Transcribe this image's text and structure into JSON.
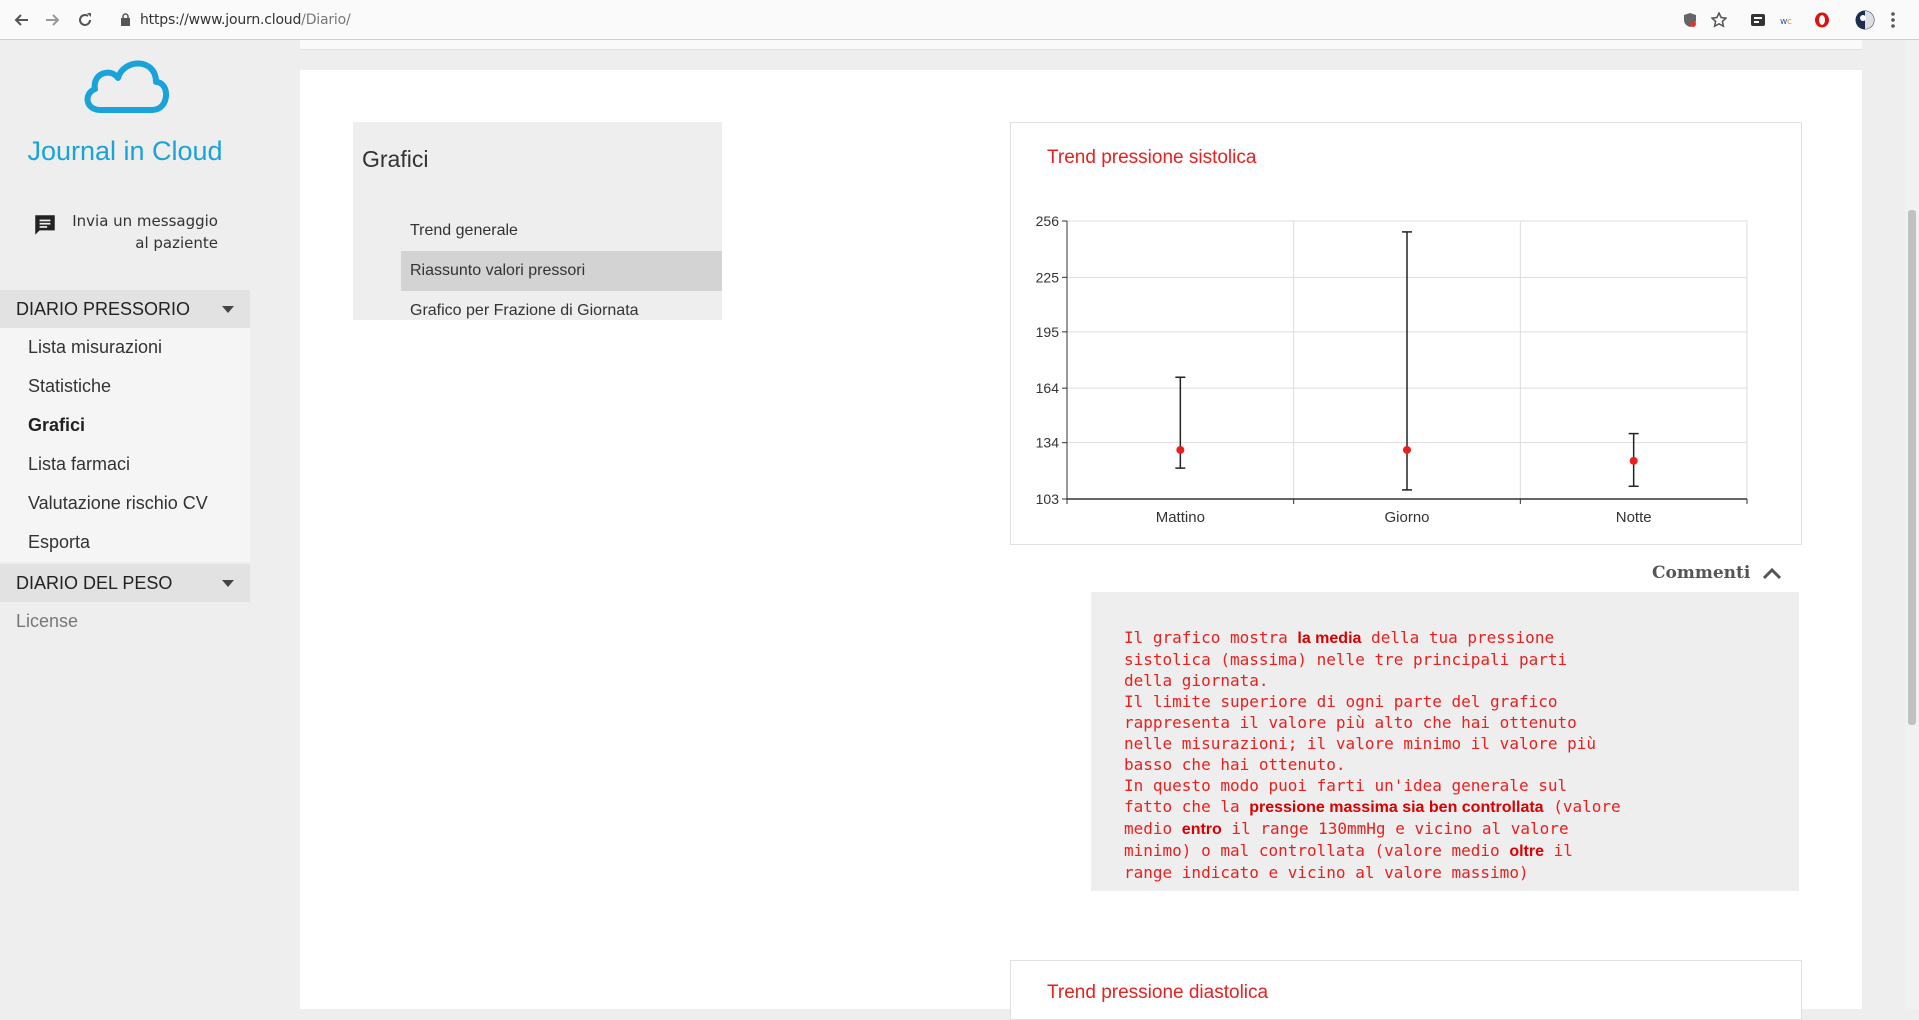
{
  "browser": {
    "url_host": "https://www.journ.cloud",
    "url_path": "/Diario/"
  },
  "sidebar": {
    "brand": "Journal in Cloud",
    "message_link": "Invia un messaggio al paziente",
    "sections": [
      {
        "title": "DIARIO PRESSORIO",
        "items": [
          "Lista misurazioni",
          "Statistiche",
          "Grafici",
          "Lista farmaci",
          "Valutazione rischio CV",
          "Esporta"
        ],
        "active": "Grafici"
      },
      {
        "title": "DIARIO DEL PESO",
        "items": []
      }
    ],
    "license": "License"
  },
  "submenu": {
    "title": "Grafici",
    "items": [
      "Trend generale",
      "Riassunto valori pressori",
      "Grafico per Frazione di Giornata"
    ],
    "active": "Riassunto valori pressori"
  },
  "chart_data": {
    "type": "errorbar",
    "title": "Trend pressione sistolica",
    "categories": [
      "Mattino",
      "Giorno",
      "Notte"
    ],
    "mean": [
      130,
      130,
      124
    ],
    "max": [
      170,
      250,
      139
    ],
    "min": [
      120,
      108,
      110
    ],
    "yticks": [
      103,
      134,
      164,
      195,
      225,
      256
    ],
    "ylim": [
      103,
      256
    ],
    "grid": true,
    "colors": {
      "point": "#e8201f",
      "bar": "#222222"
    }
  },
  "comments": {
    "header": "Commenti",
    "p1_a": "Il grafico mostra ",
    "p1_b": "la media",
    "p1_c": " della tua pressione sistolica (massima) nelle tre principali parti della giornata.",
    "p2": "Il limite superiore di ogni parte del grafico rappresenta il valore più alto che hai ottenuto nelle misurazioni; il valore minimo il valore più basso che hai ottenuto.",
    "p3_a": "In questo modo puoi farti un'idea generale sul fatto che la ",
    "p3_b": "pressione massima sia ben controllata",
    "p3_c": " (valore medio ",
    "p3_d": "entro",
    "p3_e": " il range 130mmHg e vicino al valore minimo) o mal controllata (valore medio ",
    "p3_f": "oltre",
    "p3_g": " il range indicato e vicino al valore massimo)"
  },
  "chart2": {
    "title": "Trend pressione diastolica"
  },
  "colors": {
    "accent": "#e8201f",
    "brand": "#1aa3d9"
  }
}
